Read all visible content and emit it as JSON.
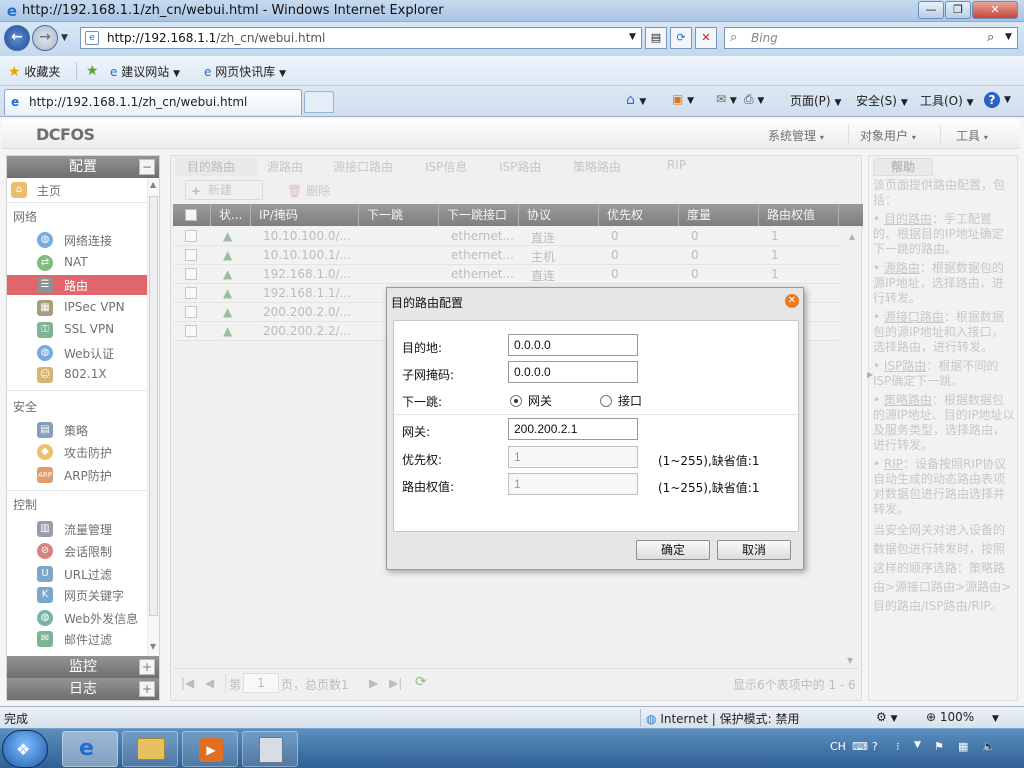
{
  "window": {
    "title": "http://192.168.1.1/zh_cn/webui.html - Windows Internet Explorer"
  },
  "address": {
    "host": "http://192.168.1.1",
    "path": "/zh_cn/webui.html",
    "search_placeholder": "Bing"
  },
  "favorites": {
    "favorites_label": "收藏夹",
    "suggested_sites": "建议网站",
    "web_slices": "网页快讯库"
  },
  "tab": {
    "title": "http://192.168.1.1/zh_cn/webui.html"
  },
  "commandbar": {
    "page": "页面(P)",
    "safety": "安全(S)",
    "tools": "工具(O)"
  },
  "app": {
    "logo": "DCFOS",
    "top_menu": [
      "系统管理",
      "对象用户",
      "工具"
    ]
  },
  "left": {
    "config_header": "配置",
    "monitor_header": "监控",
    "log_header": "日志",
    "home": "主页",
    "groups": {
      "network": "网络",
      "security": "安全",
      "control": "控制"
    },
    "network_items": [
      "网络连接",
      "NAT",
      "路由",
      "IPSec VPN",
      "SSL VPN",
      "Web认证",
      "802.1X"
    ],
    "security_items": [
      "策略",
      "攻击防护",
      "ARP防护"
    ],
    "control_items": [
      "流量管理",
      "会话限制",
      "URL过滤",
      "网页关键字",
      "Web外发信息",
      "邮件过滤"
    ]
  },
  "main": {
    "tabs": [
      "目的路由",
      "源路由",
      "源接口路由",
      "ISP信息",
      "ISP路由",
      "策略路由",
      "RIP"
    ],
    "toolbar": {
      "new": "新建",
      "delete": "删除"
    },
    "columns": [
      "状...",
      "IP/掩码",
      "下一跳",
      "下一跳接口",
      "协议",
      "优先权",
      "度量",
      "路由权值"
    ],
    "rows": [
      {
        "ip": "10.10.100.0/...",
        "next": "",
        "iface": "ethernet...",
        "proto": "直连",
        "pri": "0",
        "metric": "0",
        "weight": "1"
      },
      {
        "ip": "10.10.100.1/...",
        "next": "",
        "iface": "ethernet...",
        "proto": "主机",
        "pri": "0",
        "metric": "0",
        "weight": "1"
      },
      {
        "ip": "192.168.1.0/...",
        "next": "",
        "iface": "ethernet...",
        "proto": "直连",
        "pri": "0",
        "metric": "0",
        "weight": "1"
      },
      {
        "ip": "192.168.1.1/...",
        "next": "",
        "iface": "",
        "proto": "",
        "pri": "",
        "metric": "",
        "weight": ""
      },
      {
        "ip": "200.200.2.0/...",
        "next": "",
        "iface": "",
        "proto": "",
        "pri": "",
        "metric": "",
        "weight": ""
      },
      {
        "ip": "200.200.2.2/...",
        "next": "",
        "iface": "",
        "proto": "",
        "pri": "",
        "metric": "",
        "weight": ""
      }
    ],
    "pager": {
      "page_prefix": "第",
      "page_value": "1",
      "page_suffix": "页，总页数1",
      "summary": "显示6个表项中的 1 - 6"
    }
  },
  "help": {
    "title": "帮助",
    "intro": "该页面提供路由配置，包括：",
    "items": [
      {
        "name": "目的路由",
        "desc": "：手工配置的、根据目的IP地址确定下一跳的路由。"
      },
      {
        "name": "源路由",
        "desc": "：根据数据包的源IP地址，选择路由，进行转发。"
      },
      {
        "name": "源接口路由",
        "desc": "：根据数据包的源IP地址和入接口，选择路由，进行转发。"
      },
      {
        "name": "ISP路由",
        "desc": "：根据不同的ISP确定下一跳。"
      },
      {
        "name": "策略路由",
        "desc": "：根据数据包的源IP地址、目的IP地址以及服务类型，选择路由，进行转发。"
      },
      {
        "name": "RIP",
        "desc": "：设备按照RIP协议自动生成的动态路由表项对数据包进行路由选择并转发。"
      }
    ],
    "outro": "当安全网关对进入设备的数据包进行转发时，按照这样的顺序选路：策略路由>源接口路由>源路由>目的路由/ISP路由/RIP。"
  },
  "dialog": {
    "title": "目的路由配置",
    "dest_label": "目的地:",
    "dest_value": "0.0.0.0",
    "mask_label": "子网掩码:",
    "mask_value": "0.0.0.0",
    "nexthop_label": "下一跳:",
    "opt_gateway": "网关",
    "opt_interface": "接口",
    "nexthop_selected": "网关",
    "gateway_label": "网关:",
    "gateway_value": "200.200.2.1",
    "priority_label": "优先权:",
    "priority_value": "1",
    "priority_hint": "(1~255),缺省值:1",
    "weight_label": "路由权值:",
    "weight_value": "1",
    "weight_hint": "(1~255),缺省值:1",
    "ok": "确定",
    "cancel": "取消"
  },
  "statusbar": {
    "left": "完成",
    "zone": "Internet | 保护模式: 禁用",
    "zoom": "100%"
  },
  "taskbar": {
    "lang": "CH"
  },
  "colors": {
    "selected_nav": "#d0141c",
    "header_dark": "#2a2a2a",
    "close_orange": "#f07a22"
  }
}
